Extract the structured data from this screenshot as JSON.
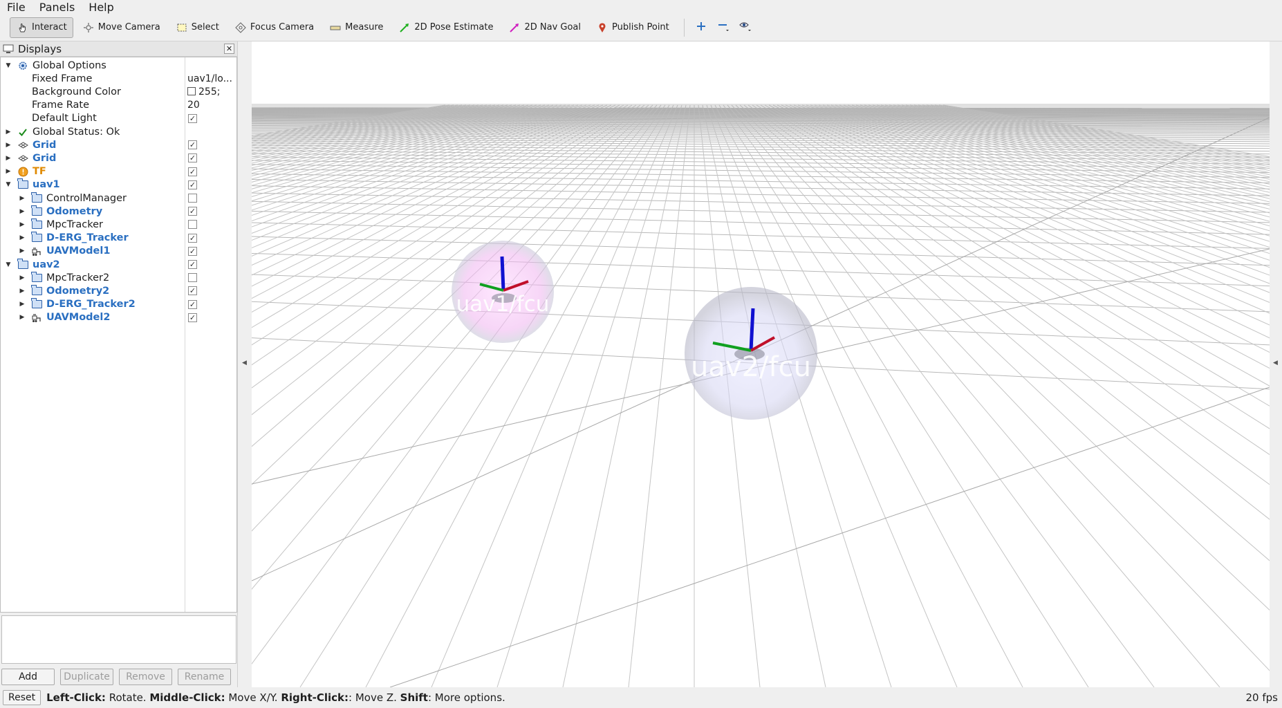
{
  "menu": {
    "file": "File",
    "panels": "Panels",
    "help": "Help"
  },
  "toolbar": {
    "interact": "Interact",
    "move_camera": "Move Camera",
    "select": "Select",
    "focus_camera": "Focus Camera",
    "measure": "Measure",
    "pose_estimate": "2D Pose Estimate",
    "nav_goal": "2D Nav Goal",
    "publish_point": "Publish Point"
  },
  "displays_panel": {
    "title": "Displays",
    "rows": [
      {
        "label": "Global Options",
        "value": "",
        "checked": null
      },
      {
        "label": "Fixed Frame",
        "value": "uav1/lo...",
        "checked": null
      },
      {
        "label": "Background Color",
        "value": "255;",
        "checked": null
      },
      {
        "label": "Frame Rate",
        "value": "20",
        "checked": null
      },
      {
        "label": "Default Light",
        "value": "",
        "checked": true
      },
      {
        "label": "Global Status: Ok",
        "value": "",
        "checked": null
      },
      {
        "label": "Grid",
        "value": "",
        "checked": true
      },
      {
        "label": "Grid",
        "value": "",
        "checked": true
      },
      {
        "label": "TF",
        "value": "",
        "checked": true
      },
      {
        "label": "uav1",
        "value": "",
        "checked": true
      },
      {
        "label": "ControlManager",
        "value": "",
        "checked": false
      },
      {
        "label": "Odometry",
        "value": "",
        "checked": true
      },
      {
        "label": "MpcTracker",
        "value": "",
        "checked": false
      },
      {
        "label": "D-ERG_Tracker",
        "value": "",
        "checked": true
      },
      {
        "label": "UAVModel1",
        "value": "",
        "checked": true
      },
      {
        "label": "uav2",
        "value": "",
        "checked": true
      },
      {
        "label": "MpcTracker2",
        "value": "",
        "checked": false
      },
      {
        "label": "Odometry2",
        "value": "",
        "checked": true
      },
      {
        "label": "D-ERG_Tracker2",
        "value": "",
        "checked": true
      },
      {
        "label": "UAVModel2",
        "value": "",
        "checked": true
      }
    ],
    "buttons": {
      "add": "Add",
      "duplicate": "Duplicate",
      "remove": "Remove",
      "rename": "Rename"
    }
  },
  "viewport": {
    "uav1_label": "uav1/fcu",
    "uav2_label": "uav2/fcu"
  },
  "statusbar": {
    "reset": "Reset",
    "left_click": "Left-Click:",
    "left_click_desc": " Rotate. ",
    "middle_click": "Middle-Click:",
    "middle_click_desc": " Move X/Y. ",
    "right_click": "Right-Click:",
    "right_click_desc": ": Move Z. ",
    "shift": "Shift",
    "shift_desc": ": More options.",
    "fps": "20 fps"
  },
  "colors": {
    "link_blue": "#2a6fc1",
    "warning_orange": "#e08a00",
    "axis_x": "#c0102a",
    "axis_y": "#10a020",
    "axis_z": "#1010d0"
  }
}
